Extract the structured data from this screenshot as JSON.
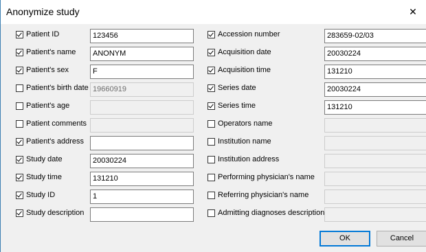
{
  "window": {
    "title": "Anonymize study",
    "close_glyph": "✕"
  },
  "left_fields": [
    {
      "label": "Patient ID",
      "checked": true,
      "value": "123456",
      "enabled": true
    },
    {
      "label": "Patient's name",
      "checked": true,
      "value": "ANONYM",
      "enabled": true
    },
    {
      "label": "Patient's sex",
      "checked": true,
      "value": "F",
      "enabled": true
    },
    {
      "label": "Patient's birth date",
      "checked": false,
      "value": "19660919",
      "enabled": false
    },
    {
      "label": "Patient's age",
      "checked": false,
      "value": "",
      "enabled": false
    },
    {
      "label": "Patient comments",
      "checked": false,
      "value": "",
      "enabled": false
    },
    {
      "label": "Patient's address",
      "checked": true,
      "value": "",
      "enabled": true
    },
    {
      "label": "Study date",
      "checked": true,
      "value": "20030224",
      "enabled": true
    },
    {
      "label": "Study time",
      "checked": true,
      "value": "131210",
      "enabled": true
    },
    {
      "label": "Study ID",
      "checked": true,
      "value": "1",
      "enabled": true
    },
    {
      "label": "Study description",
      "checked": true,
      "value": "",
      "enabled": true
    }
  ],
  "right_fields": [
    {
      "label": "Accession number",
      "checked": true,
      "value": "283659-02/03",
      "enabled": true
    },
    {
      "label": "Acquisition date",
      "checked": true,
      "value": "20030224",
      "enabled": true
    },
    {
      "label": "Acquisition time",
      "checked": true,
      "value": "131210",
      "enabled": true
    },
    {
      "label": "Series date",
      "checked": true,
      "value": "20030224",
      "enabled": true
    },
    {
      "label": "Series time",
      "checked": true,
      "value": "131210",
      "enabled": true
    },
    {
      "label": "Operators name",
      "checked": false,
      "value": "",
      "enabled": false
    },
    {
      "label": "Institution name",
      "checked": false,
      "value": "",
      "enabled": false
    },
    {
      "label": "Institution address",
      "checked": false,
      "value": "",
      "enabled": false
    },
    {
      "label": "Performing physician's name",
      "checked": false,
      "value": "",
      "enabled": false
    },
    {
      "label": "Referring physician's name",
      "checked": false,
      "value": "",
      "enabled": false
    },
    {
      "label": "Admitting diagnoses description",
      "checked": false,
      "value": "",
      "enabled": false
    }
  ],
  "buttons": {
    "ok_label": "OK",
    "cancel_label": "Cancel"
  },
  "icons": {
    "close": "close-icon",
    "checkbox": "checkmark-icon"
  }
}
